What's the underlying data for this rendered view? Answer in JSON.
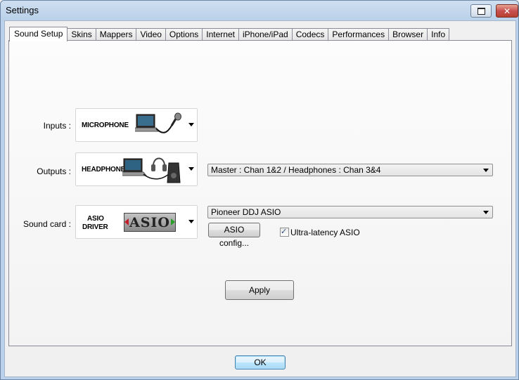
{
  "window": {
    "title": "Settings"
  },
  "tabs": [
    {
      "label": "Sound Setup",
      "active": true
    },
    {
      "label": "Skins"
    },
    {
      "label": "Mappers"
    },
    {
      "label": "Video"
    },
    {
      "label": "Options"
    },
    {
      "label": "Internet"
    },
    {
      "label": "iPhone/iPad"
    },
    {
      "label": "Codecs"
    },
    {
      "label": "Performances"
    },
    {
      "label": "Browser"
    },
    {
      "label": "Info"
    }
  ],
  "sound_setup": {
    "inputs": {
      "label": "Inputs :",
      "picker_text": "MICROPHONE",
      "icon": "laptop-microphone-icon"
    },
    "outputs": {
      "label": "Outputs :",
      "picker_text": "HEADPHONES",
      "icon": "laptop-headphones-speaker-icon",
      "routing": "Master : Chan 1&2 / Headphones : Chan 3&4"
    },
    "sound_card": {
      "label": "Sound card :",
      "picker_line1": "ASIO",
      "picker_line2": "DRIVER",
      "logo_text": "ASIO",
      "device": "Pioneer DDJ ASIO",
      "config_button": "ASIO config...",
      "ultra_latency_label": "Ultra-latency ASIO",
      "ultra_latency_checked": true
    },
    "apply_button": "Apply"
  },
  "footer": {
    "ok_button": "OK"
  }
}
